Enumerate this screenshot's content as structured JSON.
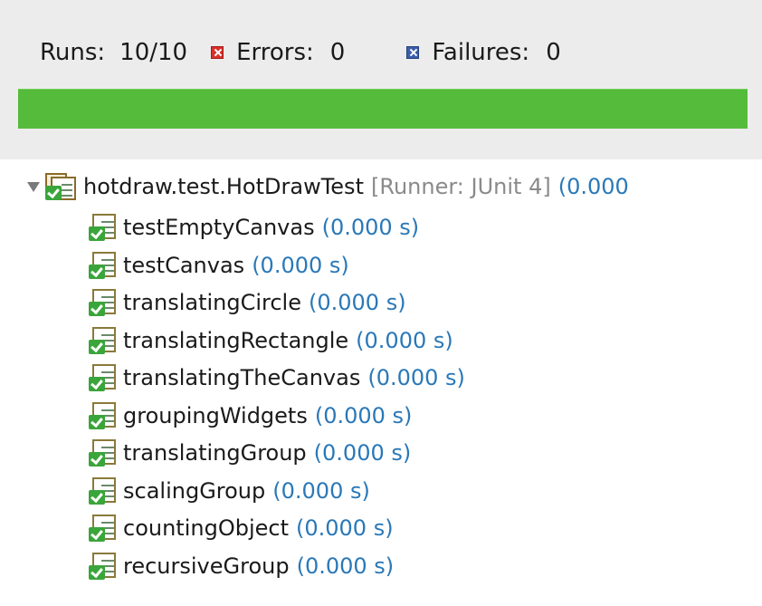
{
  "summary": {
    "runs_label": "Runs:",
    "runs_value": "10/10",
    "errors_label": "Errors:",
    "errors_value": "0",
    "failures_label": "Failures:",
    "failures_value": "0"
  },
  "progress": {
    "fraction": 1.0,
    "color": "#55bb3b"
  },
  "tree": {
    "root": {
      "name": "hotdraw.test.HotDrawTest",
      "runner": "[Runner: JUnit 4]",
      "time": "(0.000"
    },
    "tests": [
      {
        "name": "testEmptyCanvas",
        "time": "(0.000 s)"
      },
      {
        "name": "testCanvas",
        "time": "(0.000 s)"
      },
      {
        "name": "translatingCircle",
        "time": "(0.000 s)"
      },
      {
        "name": "translatingRectangle",
        "time": "(0.000 s)"
      },
      {
        "name": "translatingTheCanvas",
        "time": "(0.000 s)"
      },
      {
        "name": "groupingWidgets",
        "time": "(0.000 s)"
      },
      {
        "name": "translatingGroup",
        "time": "(0.000 s)"
      },
      {
        "name": "scalingGroup",
        "time": "(0.000 s)"
      },
      {
        "name": "countingObject",
        "time": "(0.000 s)"
      },
      {
        "name": "recursiveGroup",
        "time": "(0.000 s)"
      }
    ]
  },
  "colors": {
    "error_icon": "#d9302b",
    "failure_icon": "#3a5ea8",
    "time_text": "#2a78b8",
    "runner_text": "#8a8a8a"
  }
}
